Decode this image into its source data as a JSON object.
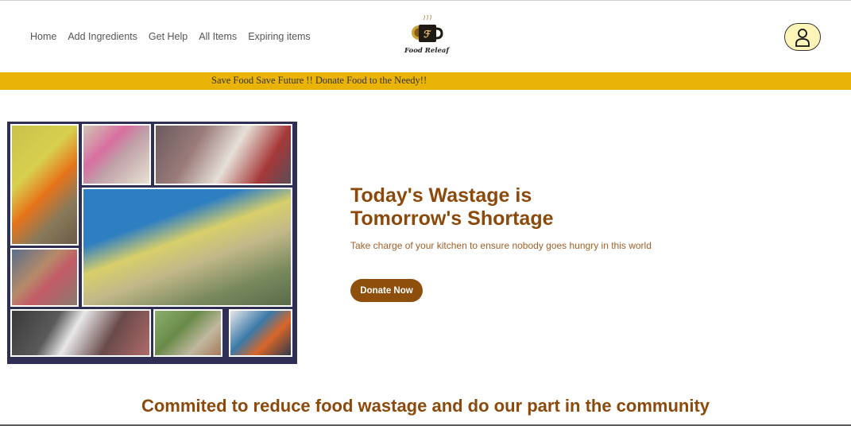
{
  "nav": {
    "items": [
      {
        "label": "Home"
      },
      {
        "label": "Add Ingredients"
      },
      {
        "label": "Get Help"
      },
      {
        "label": "All Items"
      },
      {
        "label": "Expiring items"
      }
    ]
  },
  "logo": {
    "text": "Food Releaf",
    "icon": "coffee-cup-icon"
  },
  "user": {
    "icon": "user-icon"
  },
  "banner": {
    "text": "Save Food Save Future !! Donate Food to the Needy!!"
  },
  "hero": {
    "title_line1": "Today's Wastage is",
    "title_line2": "Tomorrow's Shortage",
    "subtitle": "Take charge of your kitchen to ensure nobody goes hungry in this world",
    "button_label": "Donate Now"
  },
  "tagline": "Commited to reduce food wastage and do our part in the community",
  "colors": {
    "accent": "#8b4a0c",
    "banner": "#e9b308",
    "user_button": "#fdf5b8",
    "collage_frame": "#2f2e55"
  }
}
